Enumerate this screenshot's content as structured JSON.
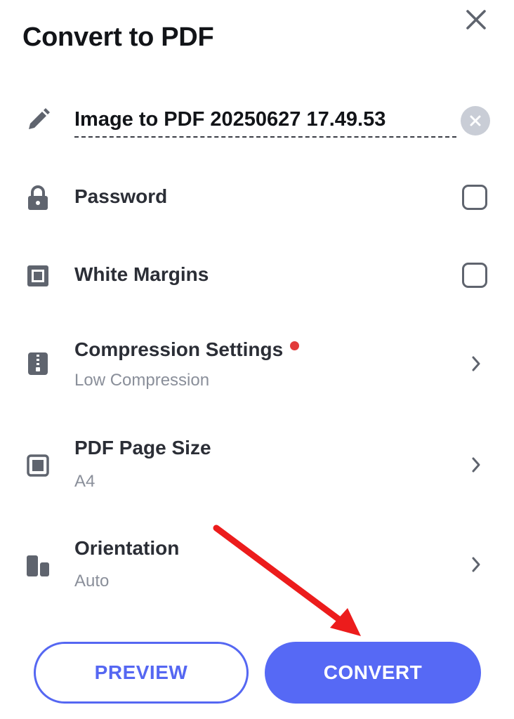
{
  "dialog": {
    "title": "Convert to PDF"
  },
  "filename": {
    "value": "Image to PDF 20250627 17.49.53"
  },
  "options": {
    "password": {
      "label": "Password",
      "checked": false
    },
    "white_margins": {
      "label": "White Margins",
      "checked": false
    },
    "compression": {
      "label": "Compression Settings",
      "value": "Low Compression",
      "has_notification": true
    },
    "page_size": {
      "label": "PDF Page Size",
      "value": "A4"
    },
    "orientation": {
      "label": "Orientation",
      "value": "Auto"
    }
  },
  "actions": {
    "preview_label": "PREVIEW",
    "convert_label": "CONVERT"
  },
  "colors": {
    "accent": "#5669f5",
    "notification_dot": "#e23b3b",
    "annotation_arrow": "#ec1c1c"
  },
  "icons": {
    "close": "close-icon",
    "edit": "pencil-icon",
    "clear": "clear-icon",
    "password": "lock-icon",
    "margins": "margins-icon",
    "compression": "zip-file-icon",
    "page_size": "page-size-icon",
    "orientation": "orientation-icon",
    "chevron": "chevron-right-icon"
  }
}
